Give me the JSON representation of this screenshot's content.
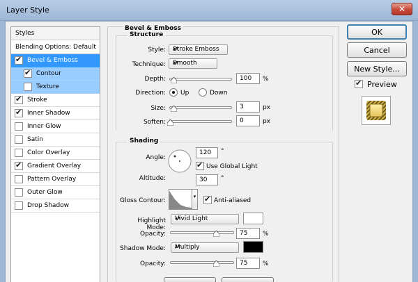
{
  "window": {
    "title": "Layer Style"
  },
  "style_list": {
    "header": "Styles",
    "blending": "Blending Options: Default",
    "items": [
      {
        "label": "Bevel & Emboss",
        "checked": true
      },
      {
        "label": "Contour",
        "checked": true
      },
      {
        "label": "Texture",
        "checked": false
      },
      {
        "label": "Stroke",
        "checked": true
      },
      {
        "label": "Inner Shadow",
        "checked": true
      },
      {
        "label": "Inner Glow",
        "checked": false
      },
      {
        "label": "Satin",
        "checked": false
      },
      {
        "label": "Color Overlay",
        "checked": false
      },
      {
        "label": "Gradient Overlay",
        "checked": true
      },
      {
        "label": "Pattern Overlay",
        "checked": false
      },
      {
        "label": "Outer Glow",
        "checked": false
      },
      {
        "label": "Drop Shadow",
        "checked": false
      }
    ]
  },
  "bevel": {
    "section_title": "Bevel & Emboss",
    "structure_title": "Structure",
    "style_label": "Style:",
    "style_value": "Stroke Emboss",
    "technique_label": "Technique:",
    "technique_value": "Smooth",
    "depth_label": "Depth:",
    "depth_value": "100",
    "depth_unit": "%",
    "direction_label": "Direction:",
    "dir_up": "Up",
    "dir_down": "Down",
    "size_label": "Size:",
    "size_value": "3",
    "size_unit": "px",
    "soften_label": "Soften:",
    "soften_value": "0",
    "soften_unit": "px"
  },
  "shading": {
    "title": "Shading",
    "angle_label": "Angle:",
    "angle_value": "120",
    "angle_unit": "°",
    "use_global_light": "Use Global Light",
    "altitude_label": "Altitude:",
    "altitude_value": "30",
    "altitude_unit": "°",
    "gloss_contour_label": "Gloss Contour:",
    "anti_aliased": "Anti-aliased",
    "highlight_mode_label": "Highlight Mode:",
    "highlight_mode_value": "Vivid Light",
    "highlight_color": "#ffffff",
    "opacity_label": "Opacity:",
    "highlight_opacity": "75",
    "opacity_unit": "%",
    "shadow_mode_label": "Shadow Mode:",
    "shadow_mode_value": "Multiply",
    "shadow_color": "#000000",
    "shadow_opacity": "75"
  },
  "buttons": {
    "ok": "OK",
    "cancel": "Cancel",
    "new_style": "New Style...",
    "preview": "Preview"
  },
  "colors": {
    "selection": "#3399ff",
    "sub_selection": "#99ccff"
  }
}
